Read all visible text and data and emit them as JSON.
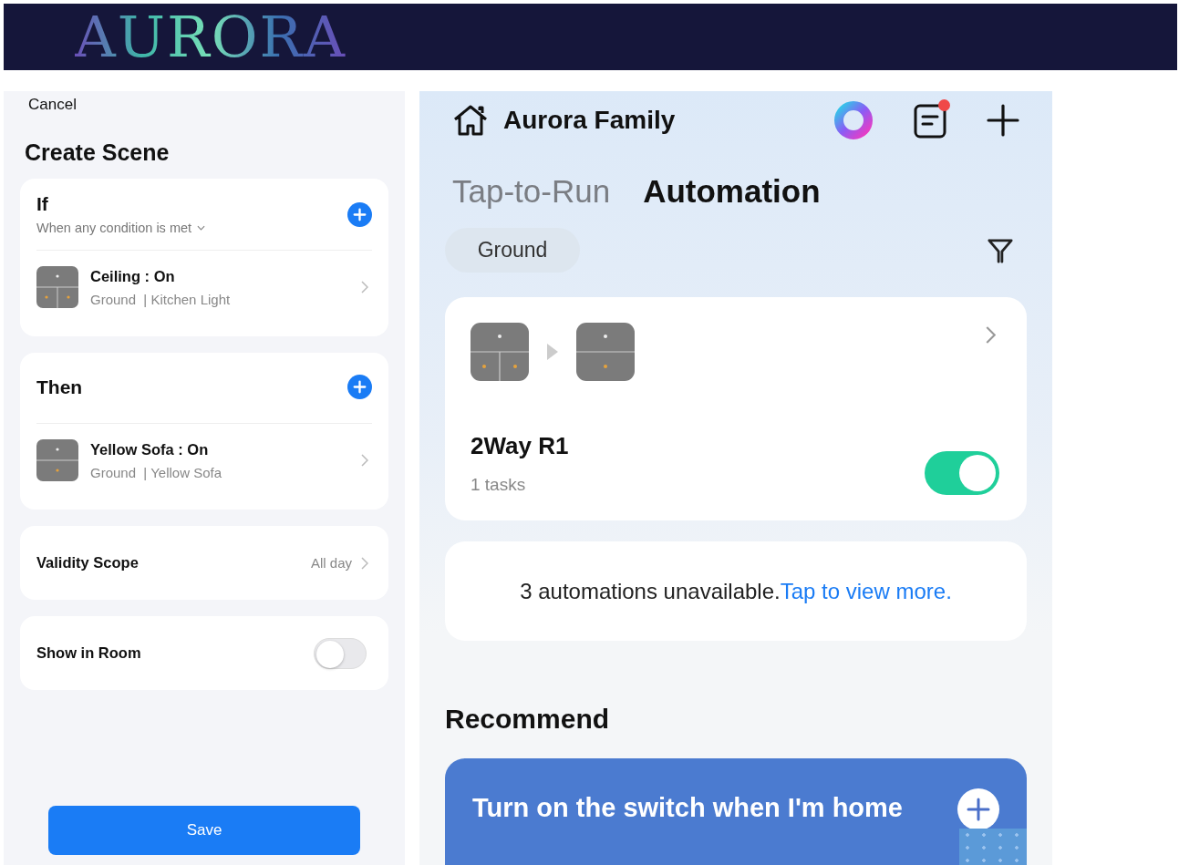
{
  "logo": "AURORA",
  "create_scene": {
    "cancel": "Cancel",
    "title": "Create Scene",
    "if_section": {
      "title": "If",
      "condition": "When any condition is met",
      "rows": [
        {
          "kind": "triple",
          "name": "Ceiling : On",
          "room": "Ground",
          "device": "| Kitchen Light"
        }
      ]
    },
    "then_section": {
      "title": "Then",
      "rows": [
        {
          "kind": "double",
          "name": "Yellow Sofa : On",
          "room": "Ground",
          "device": "| Yellow Sofa"
        }
      ]
    },
    "validity": {
      "label": "Validity Scope",
      "value": "All day"
    },
    "show_in_room": {
      "label": "Show in Room",
      "on": false
    },
    "save": "Save"
  },
  "home": {
    "title": "Aurora Family",
    "notification_dot": true,
    "tabs": [
      {
        "label": "Tap-to-Run",
        "selected": false
      },
      {
        "label": "Automation",
        "selected": true
      }
    ],
    "room_chip": "Ground",
    "automations": [
      {
        "name": "2Way R1",
        "tasks": "1 tasks",
        "on": true,
        "devices": [
          {
            "kind": "triple"
          },
          {
            "kind": "double"
          }
        ]
      }
    ],
    "unavailable": {
      "text": "3 automations unavailable.",
      "link": "Tap to view more."
    },
    "recommend": {
      "title": "Recommend",
      "cards": [
        {
          "text": "Turn on the switch when I'm home"
        }
      ]
    }
  }
}
